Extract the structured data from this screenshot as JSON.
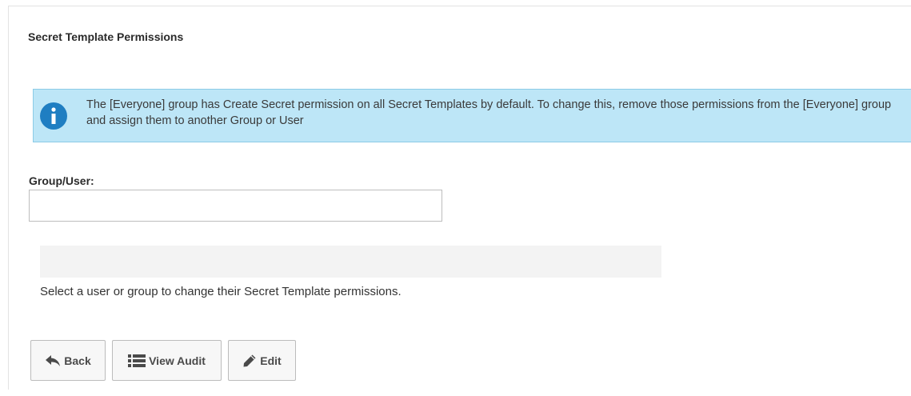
{
  "header": {
    "title": "Secret Template Permissions"
  },
  "alert": {
    "icon": "info-icon",
    "text": "The [Everyone] group has Create Secret permission on all Secret Templates by default. To change this, remove those permissions from the [Everyone] group and assign them to another Group or User"
  },
  "form": {
    "group_user_label": "Group/User:",
    "group_user_value": "",
    "help_text": "Select a user or group to change their Secret Template permissions."
  },
  "buttons": {
    "back": {
      "label": "Back",
      "icon": "reply-arrow-icon"
    },
    "view_audit": {
      "label": "View Audit",
      "icon": "list-icon"
    },
    "edit": {
      "label": "Edit",
      "icon": "pencil-icon"
    }
  },
  "colors": {
    "alert_bg": "#bde6f7",
    "alert_border": "#8ccbe6",
    "info_icon": "#1f7ec2"
  }
}
